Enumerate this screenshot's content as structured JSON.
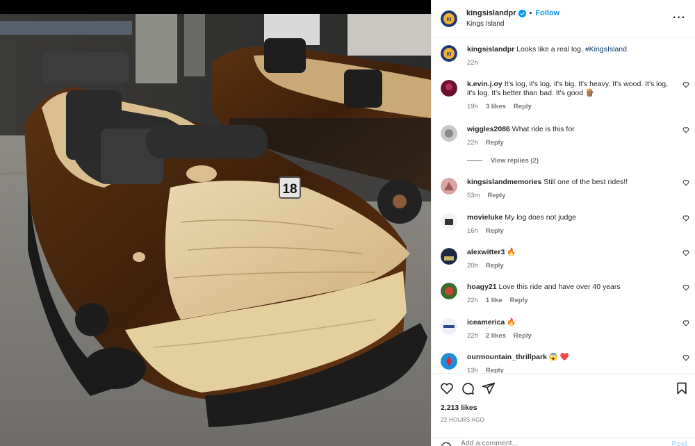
{
  "post": {
    "author": "kingsislandpr",
    "follow_label": "Follow",
    "location": "Kings Island",
    "caption_text": "Looks like a real log.",
    "caption_hashtag": "#KingsIsland",
    "caption_time": "22h",
    "photo_badge_number": "18"
  },
  "comments": [
    {
      "user": "k.evin.j.oy",
      "text": "It's log, it's log, it's big. It's heavy. It's wood. It's log, it's log. It's better than bad. It's good 🪵",
      "time": "19h",
      "likes": "3 likes",
      "reply": "Reply"
    },
    {
      "user": "wiggles2086",
      "text": "What ride is this for",
      "time": "22h",
      "likes": "",
      "reply": "Reply"
    },
    {
      "user": "kingsislandmemories",
      "text": "Still one of the best rides!!",
      "time": "53m",
      "likes": "",
      "reply": "Reply"
    },
    {
      "user": "movieluke",
      "text": "My log does not judge",
      "time": "16h",
      "likes": "",
      "reply": "Reply"
    },
    {
      "user": "alexwitter3",
      "text": "🔥",
      "time": "20h",
      "likes": "",
      "reply": "Reply"
    },
    {
      "user": "hoagy21",
      "text": "Love this ride and have over 40 years",
      "time": "22h",
      "likes": "1 like",
      "reply": "Reply"
    },
    {
      "user": "iceamerica",
      "text": "🔥",
      "time": "22h",
      "likes": "2 likes",
      "reply": "Reply"
    },
    {
      "user": "ourmountain_thrillpark",
      "text": "😱 ❤️",
      "time": "13h",
      "likes": "",
      "reply": "Reply"
    }
  ],
  "view_replies": "View replies (2)",
  "likes_count": "2,213 likes",
  "timestamp": "22 HOURS AGO",
  "add_comment_placeholder": "Add a comment...",
  "post_button": "Post",
  "colors": {
    "accent": "#0095f6",
    "like_red": "#ed4956",
    "muted": "#737373"
  },
  "icons": [
    "verified-badge-icon",
    "more-options-icon",
    "heart-icon",
    "comment-icon",
    "share-icon",
    "bookmark-icon",
    "emoji-icon"
  ]
}
